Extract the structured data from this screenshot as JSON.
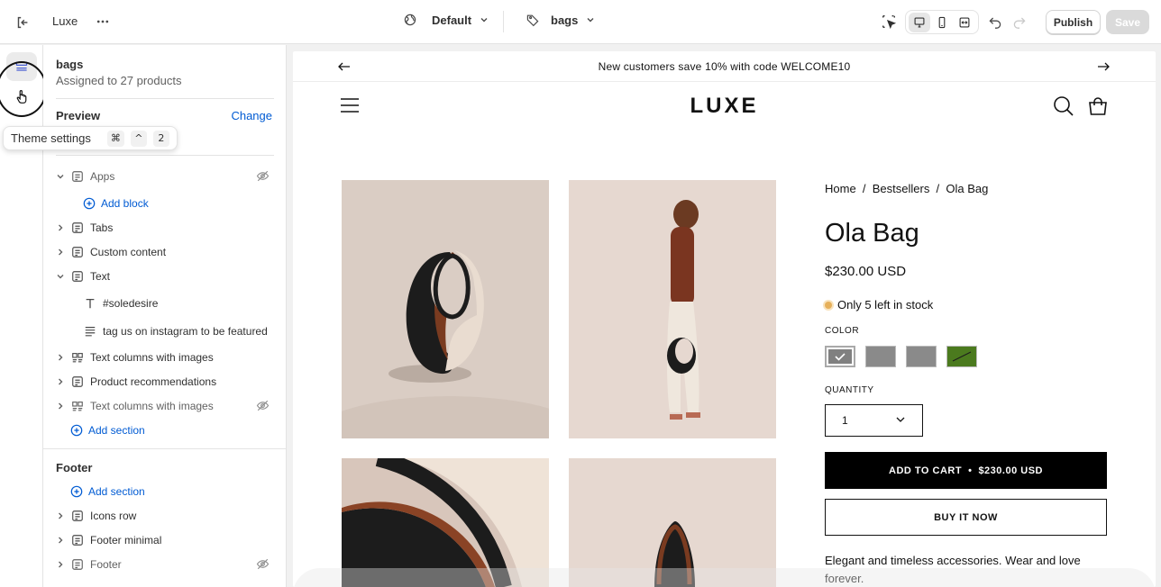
{
  "topbar": {
    "store_name": "Luxe",
    "theme_label": "Default",
    "template_label": "bags",
    "publish_label": "Publish",
    "save_label": "Save",
    "icons": [
      "exit-icon",
      "more-icon",
      "globe-icon",
      "tag-icon",
      "inspector-icon",
      "desktop-icon",
      "mobile-icon",
      "fullwidth-icon",
      "undo-icon",
      "redo-icon"
    ]
  },
  "sidebar": {
    "title": "bags",
    "subtitle": "Assigned to 27 products",
    "preview_label": "Preview",
    "change_label": "Change",
    "tooltip": {
      "label": "Theme settings",
      "keys": [
        "⌘",
        "^",
        "2"
      ]
    },
    "tree": [
      {
        "label": "Apps",
        "hidden": true
      },
      {
        "label": "Add block"
      },
      {
        "label": "Tabs"
      },
      {
        "label": "Custom content"
      },
      {
        "label": "Text"
      },
      {
        "label": "#soledesire"
      },
      {
        "label": "tag us on instagram to be featured"
      },
      {
        "label": "Text columns with images"
      },
      {
        "label": "Product recommendations"
      },
      {
        "label": "Text columns with images",
        "hidden": true
      },
      {
        "label": "Add section"
      }
    ],
    "footer_label": "Footer",
    "footer_tree": [
      {
        "label": "Add section"
      },
      {
        "label": "Icons row"
      },
      {
        "label": "Footer minimal"
      },
      {
        "label": "Footer",
        "hidden": true
      }
    ]
  },
  "preview": {
    "announcement": "New customers save 10% with code WELCOME10",
    "logo": "LUXE",
    "breadcrumb": "Home  /  Bestsellers  /  Ola Bag",
    "product_name": "Ola Bag",
    "price": "$230.00 USD",
    "stock": "Only 5 left in stock",
    "color_label": "COLOR",
    "swatch_colors": [
      "#808080",
      "#8a8a8a",
      "#8a8a8a",
      "#4b7a1e"
    ],
    "quantity_label": "QUANTITY",
    "quantity_value": "1",
    "add_to_cart": "ADD TO CART",
    "add_to_cart_price": "$230.00 USD",
    "buy_now": "BUY IT NOW",
    "description": "Elegant and timeless accessories. Wear and love forever."
  }
}
